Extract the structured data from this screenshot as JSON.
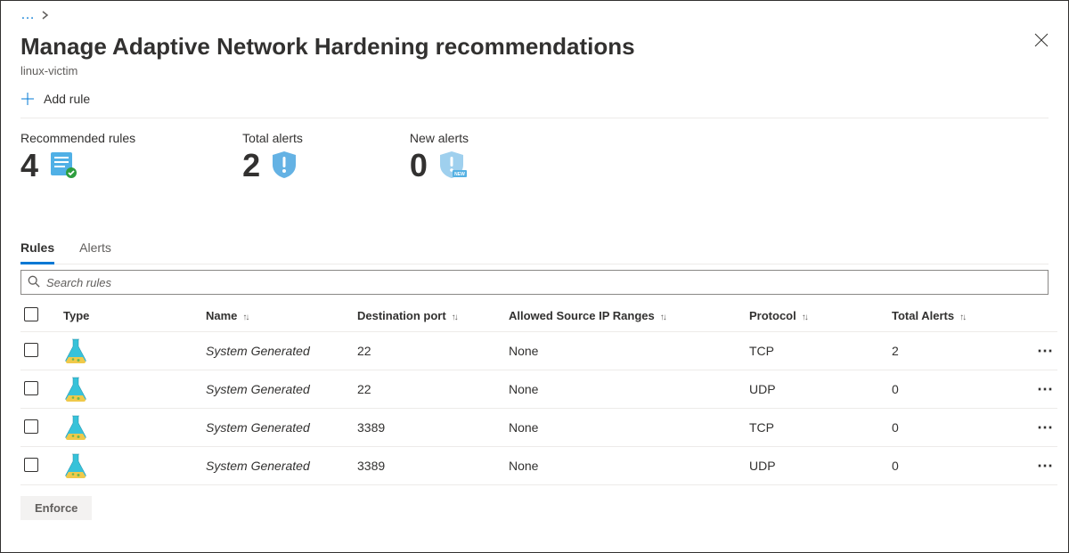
{
  "page_title": "Manage Adaptive Network Hardening recommendations",
  "resource_name": "linux-victim",
  "add_rule_label": "Add rule",
  "stats": {
    "recommended_rules_label": "Recommended rules",
    "recommended_rules_value": "4",
    "total_alerts_label": "Total alerts",
    "total_alerts_value": "2",
    "new_alerts_label": "New alerts",
    "new_alerts_value": "0"
  },
  "tabs": {
    "rules": "Rules",
    "alerts": "Alerts",
    "active": "rules"
  },
  "search": {
    "placeholder": "Search rules"
  },
  "columns": {
    "type": "Type",
    "name": "Name",
    "dest_port": "Destination port",
    "allowed_src": "Allowed Source IP Ranges",
    "protocol": "Protocol",
    "total_alerts": "Total Alerts"
  },
  "rows": [
    {
      "name": "System Generated",
      "port": "22",
      "src": "None",
      "protocol": "TCP",
      "alerts": "2"
    },
    {
      "name": "System Generated",
      "port": "22",
      "src": "None",
      "protocol": "UDP",
      "alerts": "0"
    },
    {
      "name": "System Generated",
      "port": "3389",
      "src": "None",
      "protocol": "TCP",
      "alerts": "0"
    },
    {
      "name": "System Generated",
      "port": "3389",
      "src": "None",
      "protocol": "UDP",
      "alerts": "0"
    }
  ],
  "enforce_label": "Enforce"
}
